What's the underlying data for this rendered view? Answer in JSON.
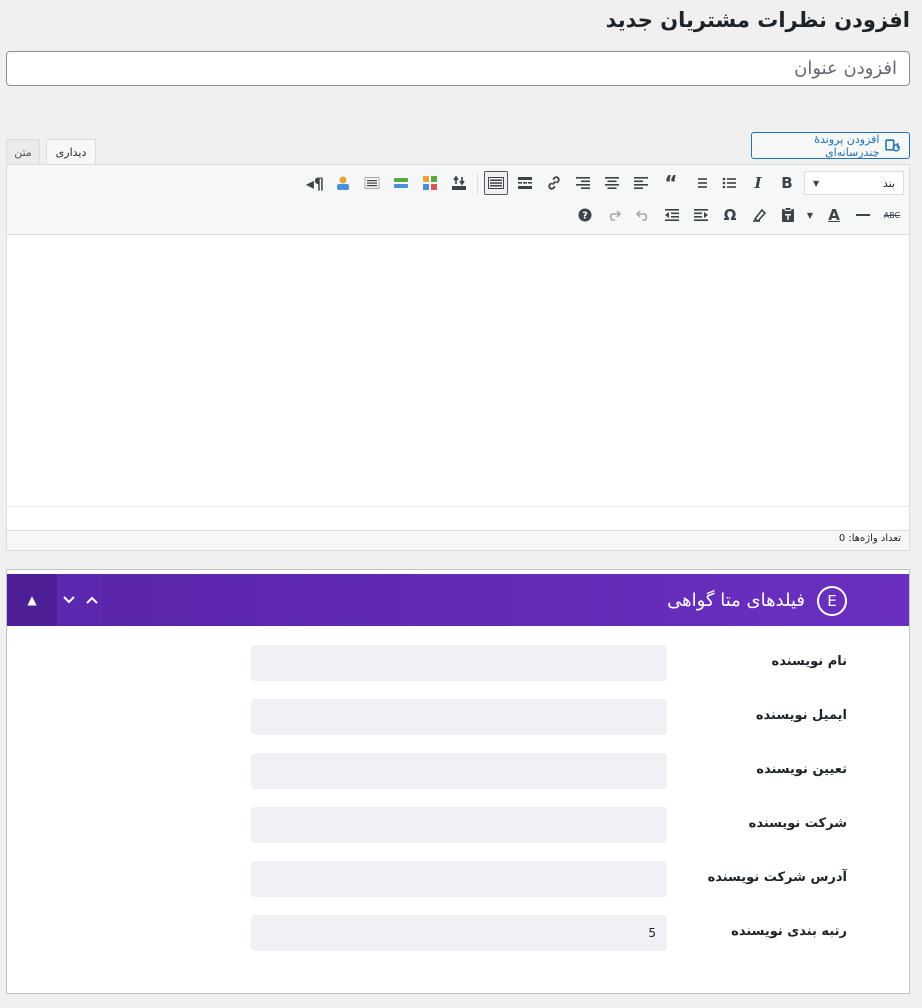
{
  "page": {
    "title": "افزودن نظرات مشتریان جدید"
  },
  "title_field": {
    "placeholder": "افزودن عنوان"
  },
  "media_button": {
    "label": "افزودن پروندهٔ چندرسانه‌ای",
    "icon": "media-icon"
  },
  "tabs": {
    "visual": "دیداری",
    "text": "متن"
  },
  "toolbar": {
    "format_select": "بند",
    "row1_icons": [
      "bold-icon",
      "italic-icon",
      "bullet-list-icon",
      "numbered-list-icon",
      "blockquote-icon",
      "align-right-icon",
      "align-center-icon",
      "align-left-icon",
      "link-icon",
      "read-more-icon",
      "toolbar-toggle-icon",
      "upload-icon",
      "grid-icon",
      "layers-icon",
      "lines-icon",
      "user-icon",
      "paragraph-icon"
    ],
    "row2_icons": [
      "strikethrough-icon",
      "hr-icon",
      "text-color-icon",
      "paste-text-icon",
      "clear-format-icon",
      "special-char-icon",
      "outdent-icon",
      "indent-icon",
      "undo-icon",
      "redo-icon",
      "help-icon"
    ]
  },
  "editor": {
    "word_count": "تعداد واژه‌ها: 0"
  },
  "metabox": {
    "title": "فیلدهای متا گواهی",
    "logo": "E",
    "fields": [
      {
        "label": "نام نویسنده",
        "value": ""
      },
      {
        "label": "ایمیل نویسنده",
        "value": ""
      },
      {
        "label": "تعیین نویسنده",
        "value": ""
      },
      {
        "label": "شرکت نویسنده",
        "value": ""
      },
      {
        "label": "آدرس شرکت نویسنده",
        "value": ""
      },
      {
        "label": "رتبه بندی نویسنده",
        "value": "5"
      }
    ]
  },
  "colors": {
    "accent": "#2271b1",
    "metabox_header": "#6a2fc0"
  }
}
